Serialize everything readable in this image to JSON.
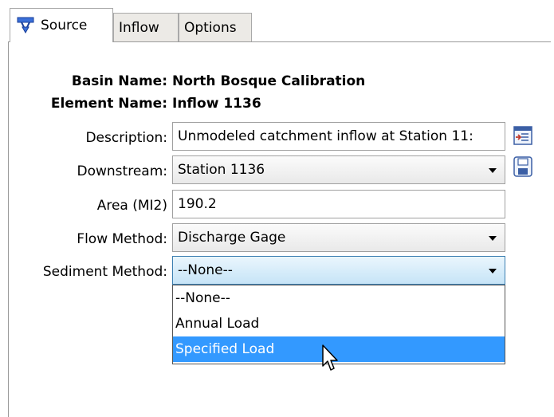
{
  "tabs": [
    {
      "label": "Source",
      "icon": "source-node-icon"
    },
    {
      "label": "Inflow"
    },
    {
      "label": "Options"
    }
  ],
  "header": {
    "basin_label": "Basin Name:",
    "basin_value": "North Bosque Calibration",
    "element_label": "Element Name:",
    "element_value": "Inflow 1136"
  },
  "form": {
    "description": {
      "label": "Description:",
      "value": "Unmodeled catchment inflow at Station 11:"
    },
    "downstream": {
      "label": "Downstream:",
      "value": "Station 1136"
    },
    "area": {
      "label": "Area (MI2)",
      "value": "190.2"
    },
    "flow_method": {
      "label": "Flow Method:",
      "value": "Discharge Gage"
    },
    "sediment_method": {
      "label": "Sediment Method:",
      "value": "--None--"
    }
  },
  "dropdown": {
    "options": [
      "--None--",
      "Annual Load",
      "Specified Load"
    ],
    "highlighted": "Specified Load"
  },
  "colors": {
    "highlight": "#3399ff",
    "focus_border": "#3c7fb1"
  }
}
